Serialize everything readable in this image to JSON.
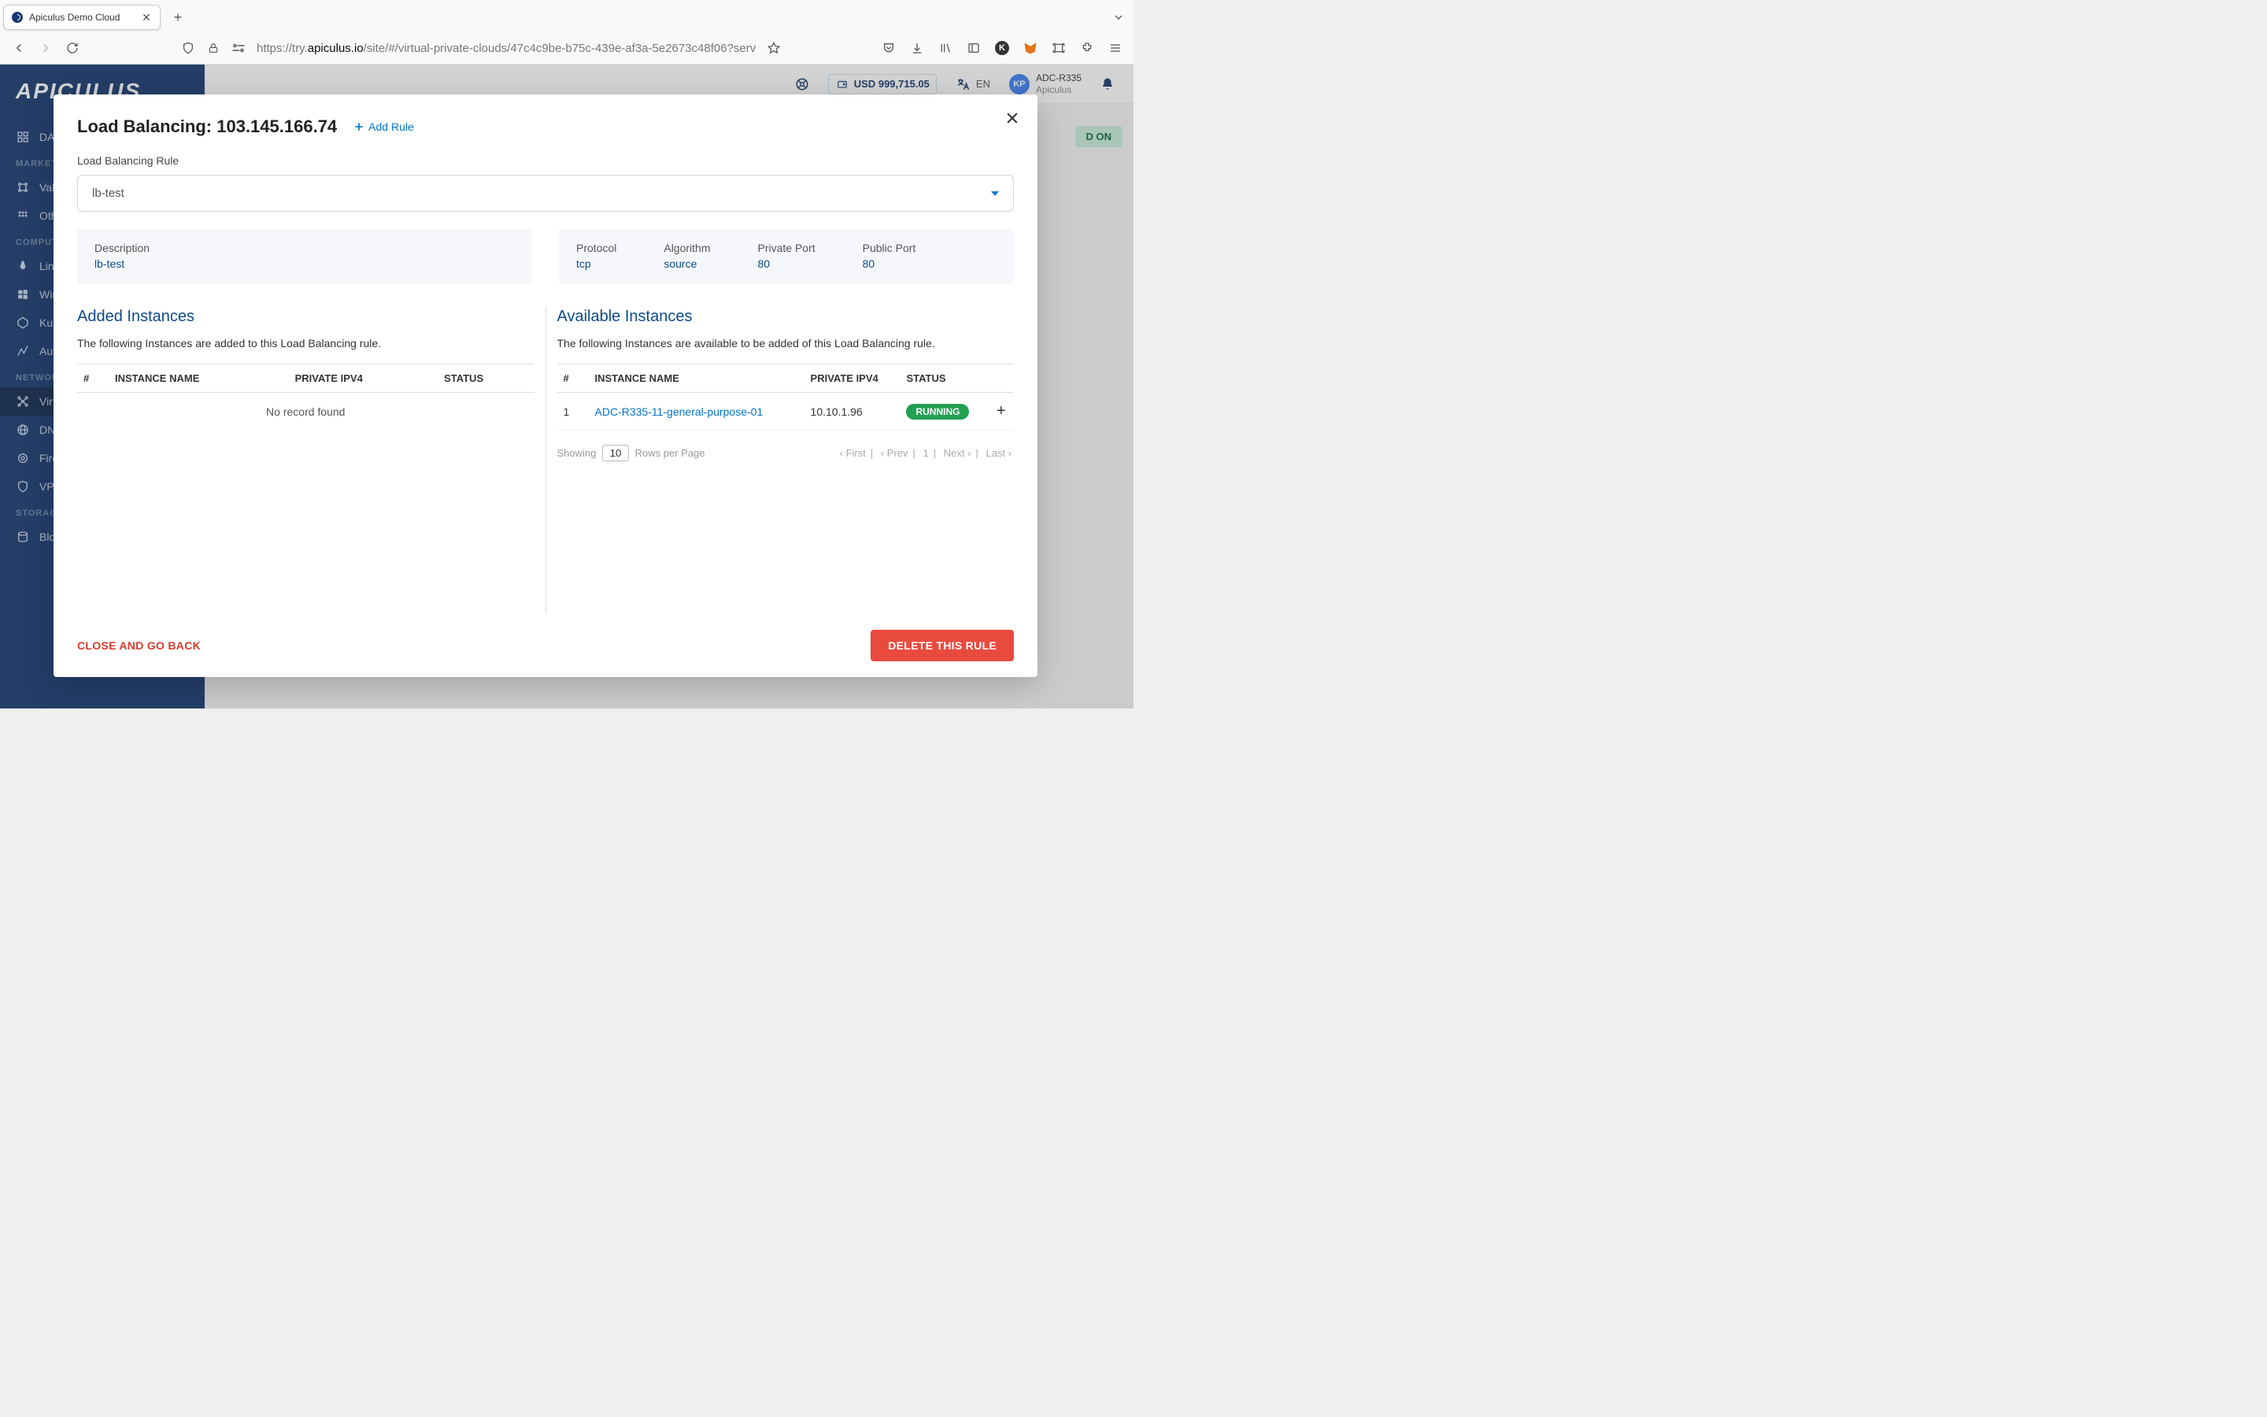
{
  "browser": {
    "tab_title": "Apiculus Demo Cloud",
    "url_prefix": "https://try.",
    "url_host": "apiculus.io",
    "url_suffix": "/site/#/virtual-private-clouds/47c4c9be-b75c-439e-af3a-5e2673c48f06?serviceId="
  },
  "header": {
    "balance": "USD 999,715.05",
    "language": "EN",
    "avatar_initials": "KP",
    "username": "ADC-R335",
    "org": "Apiculus"
  },
  "sidebar": {
    "dashboard": "DASHBOARD",
    "marketplace_label": "MARKETPLACE",
    "values": "Values",
    "others": "Others",
    "compute_label": "COMPUTE & STORAGE",
    "linux": "Linux Instances",
    "windows": "Windows Instances",
    "kube": "Kubernetes",
    "auto": "Autoscale Groups",
    "network_label": "NETWORKING",
    "vpc": "Virtual Private Clouds",
    "dns": "DNS Management",
    "fire": "Firewall",
    "vpn": "VPN",
    "storage_label": "STORAGE & BACKUP",
    "block": "Block Volumes"
  },
  "main_bg": {
    "toggle": "D ON"
  },
  "modal": {
    "title": "Load Balancing: 103.145.166.74",
    "add_rule": "Add Rule",
    "rule_label": "Load Balancing Rule",
    "selected_rule": "lb-test",
    "desc_label": "Description",
    "desc_value": "lb-test",
    "protocol_label": "Protocol",
    "protocol_value": "tcp",
    "algorithm_label": "Algorithm",
    "algorithm_value": "source",
    "private_port_label": "Private Port",
    "private_port_value": "80",
    "public_port_label": "Public Port",
    "public_port_value": "80",
    "added": {
      "title": "Added Instances",
      "desc": "The following Instances are added to this Load Balancing rule.",
      "col_num": "#",
      "col_name": "INSTANCE NAME",
      "col_ip": "PRIVATE IPV4",
      "col_status": "STATUS",
      "no_record": "No record found"
    },
    "available": {
      "title": "Available Instances",
      "desc": "The following Instances are available to be added of this Load Balancing rule.",
      "col_num": "#",
      "col_name": "INSTANCE NAME",
      "col_ip": "PRIVATE IPV4",
      "col_status": "STATUS",
      "rows": [
        {
          "n": "1",
          "name": "ADC-R335-11-general-purpose-01",
          "ip": "10.10.1.96",
          "status": "RUNNING"
        }
      ],
      "showing": "Showing",
      "rows_val": "10",
      "rows_per_page": "Rows per Page",
      "first": "‹ First",
      "prev": "‹ Prev",
      "page": "1",
      "next": "Next ›",
      "last": "Last ›"
    },
    "close_back": "CLOSE AND GO BACK",
    "delete": "DELETE THIS RULE"
  }
}
